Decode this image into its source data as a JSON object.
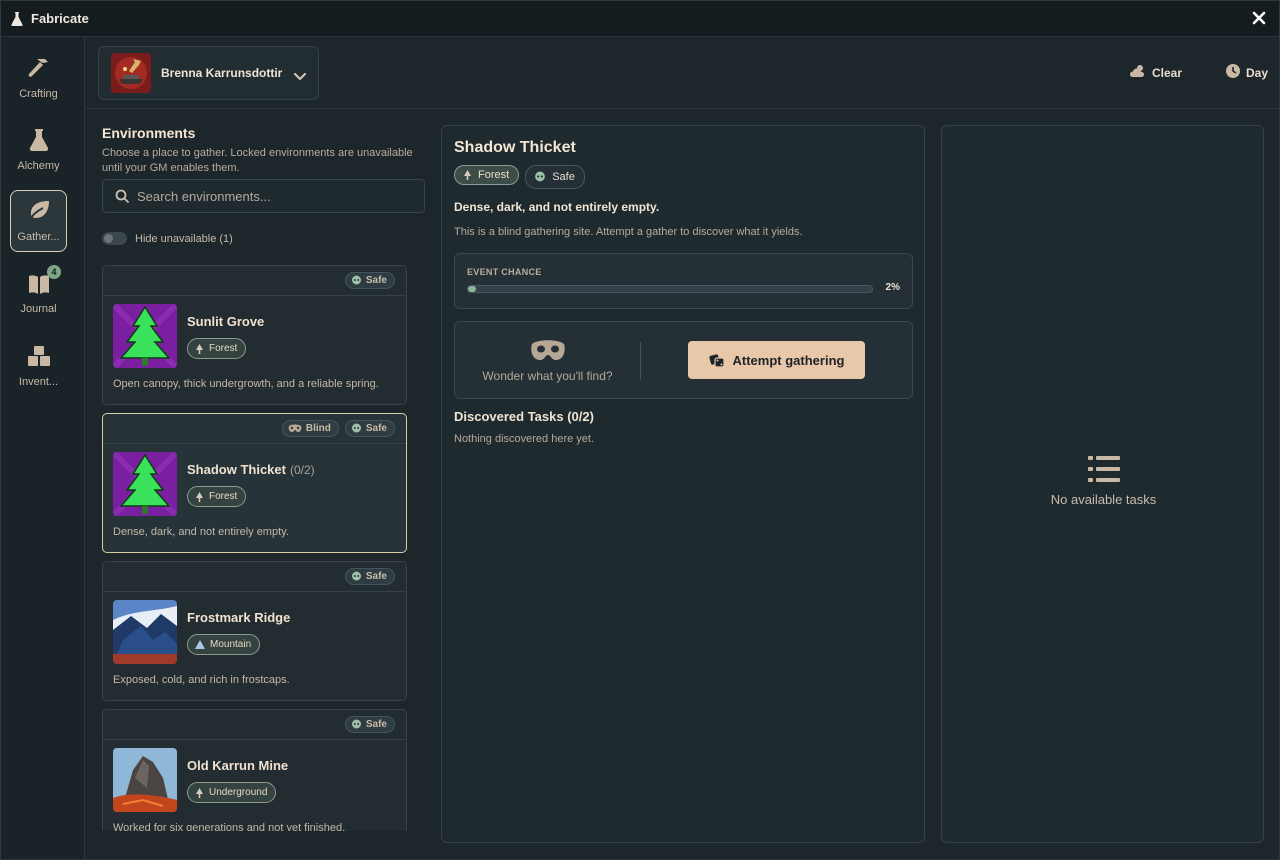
{
  "app": {
    "title": "Fabricate",
    "close_label": "close"
  },
  "colors": {
    "accent": "#e9c8a9",
    "selected_border": "#d9cca8",
    "badge": "#7ea586",
    "event_fill": "#8fb39a"
  },
  "sidebar": {
    "items": [
      {
        "label": "Crafting",
        "icon": "hammer-icon"
      },
      {
        "label": "Alchemy",
        "icon": "flask-icon"
      },
      {
        "label": "Gather...",
        "icon": "leaf-icon",
        "active": true
      },
      {
        "label": "Journal",
        "icon": "journal-icon",
        "badge": "4"
      },
      {
        "label": "Invent...",
        "icon": "boxes-icon"
      }
    ]
  },
  "topbar": {
    "character": "Brenna Karrunsdottir",
    "weather": "Clear",
    "time": "Day"
  },
  "environments": {
    "title": "Environments",
    "description": "Choose a place to gather. Locked environments are unavailable until your GM enables them.",
    "search_placeholder": "Search environments...",
    "hide_unavailable": "Hide unavailable (1)",
    "cards": [
      {
        "name": "Sunlit Grove",
        "count": "",
        "biome": "Forest",
        "description": "Open canopy, thick undergrowth, and a reliable spring.",
        "tags": [
          "Safe"
        ]
      },
      {
        "name": "Shadow Thicket",
        "count": "(0/2)",
        "biome": "Forest",
        "description": "Dense, dark, and not entirely empty.",
        "tags": [
          "Blind",
          "Safe"
        ],
        "selected": true
      },
      {
        "name": "Frostmark Ridge",
        "count": "",
        "biome": "Mountain",
        "description": "Exposed, cold, and rich in frostcaps.",
        "tags": [
          "Safe"
        ]
      },
      {
        "name": "Old Karrun Mine",
        "count": "",
        "biome": "Underground",
        "description": "Worked for six generations and not yet finished.",
        "tags": [
          "Safe"
        ]
      }
    ]
  },
  "detail": {
    "title": "Shadow Thicket",
    "tags": [
      "Forest",
      "Safe"
    ],
    "subtitle": "Dense, dark, and not entirely empty.",
    "note": "This is a blind gathering site. Attempt a gather to discover what it yields.",
    "event_label": "EVENT CHANCE",
    "event_percent": "2%",
    "event_value": 2,
    "wonder_text": "Wonder what you'll find?",
    "attempt_label": "Attempt gathering",
    "discovered_title": "Discovered Tasks (0/2)",
    "discovered_empty": "Nothing discovered here yet."
  },
  "tasks": {
    "empty_label": "No available tasks"
  }
}
